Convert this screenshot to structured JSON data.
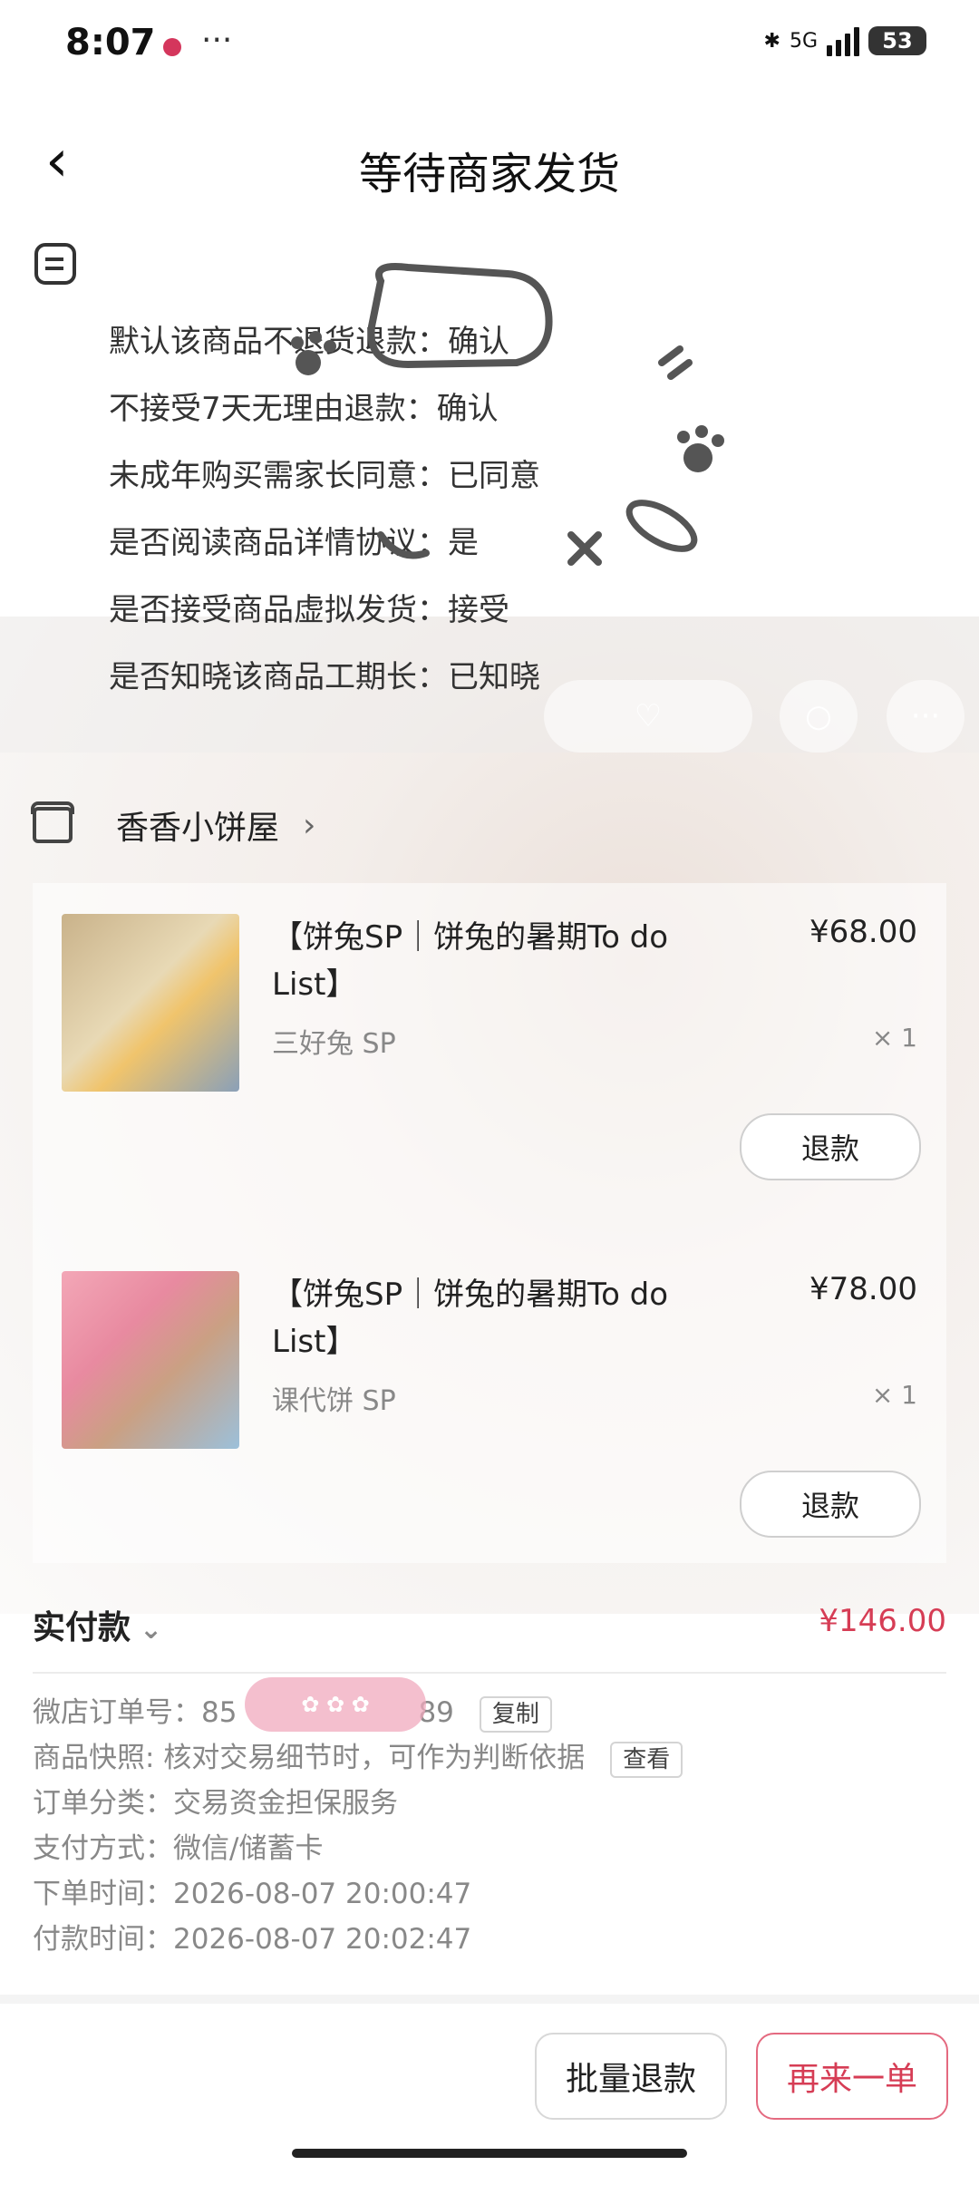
{
  "status_bar": {
    "time": "8:07",
    "network": "5G",
    "battery": "53"
  },
  "header": {
    "title": "等待商家发货"
  },
  "agreements": [
    "默认该商品不退货退款：确认",
    "不接受7天无理由退款：确认",
    "未成年购买需家长同意：已同意",
    "是否阅读商品详情协议：是",
    "是否接受商品虚拟发货：接受",
    "是否知晓该商品工期长：已知晓"
  ],
  "shop": {
    "name": "香香小饼屋"
  },
  "items": [
    {
      "name": "【饼兔SP｜饼兔的暑期To do List】",
      "sku": "三好兔 SP",
      "price": "¥68.00",
      "qty": "× 1",
      "refund_label": "退款"
    },
    {
      "name": "【饼兔SP｜饼兔的暑期To do List】",
      "sku": "课代饼 SP",
      "price": "¥78.00",
      "qty": "× 1",
      "refund_label": "退款"
    }
  ],
  "payment": {
    "label": "实付款",
    "amount": "¥146.00"
  },
  "order_info": {
    "order_no": "微店订单号：85",
    "order_no_tail": "89",
    "copy_label": "复制",
    "snapshot": "商品快照: 核对交易细节时，可作为判断依据",
    "view_label": "查看",
    "category": "订单分类：交易资金担保服务",
    "pay_method": "支付方式：微信/储蓄卡",
    "order_time": "下单时间：2026-08-07 20:00:47",
    "pay_time": "付款时间：2026-08-07 20:02:47"
  },
  "footer": {
    "bulk_refund": "批量退款",
    "reorder": "再来一单"
  },
  "colors": {
    "accent": "#d63d55"
  }
}
